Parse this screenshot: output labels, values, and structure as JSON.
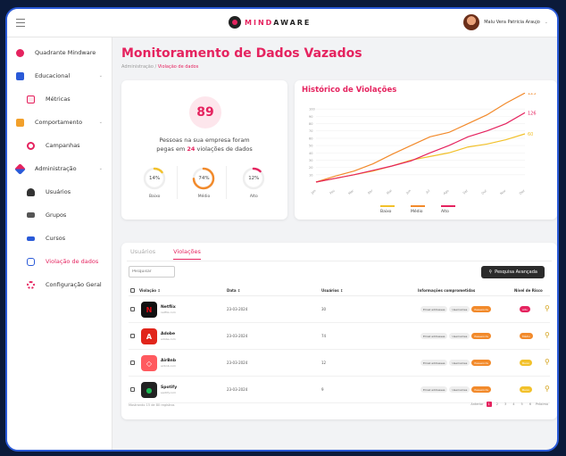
{
  "app": {
    "logo_text_a": "MIND",
    "logo_text_b": "AWARE"
  },
  "user": {
    "name": "Malu Vera Patricia Araujo"
  },
  "sidebar": {
    "items": [
      {
        "label": "Quadrante Mindware",
        "color": "#e5235f"
      },
      {
        "label": "Educacional",
        "color": "#2a5ad8"
      },
      {
        "label": "Métricas",
        "color": "#e5235f"
      },
      {
        "label": "Comportamento",
        "color": "#f2a02b"
      },
      {
        "label": "Campanhas",
        "color": "#e5235f"
      },
      {
        "label": "Administração",
        "color": "#2a5ad8"
      },
      {
        "label": "Usuários",
        "color": "#333333"
      },
      {
        "label": "Grupos",
        "color": "#333333"
      },
      {
        "label": "Cursos",
        "color": "#2a5ad8"
      },
      {
        "label": "Violação de dados",
        "color": "#e5235f"
      },
      {
        "label": "Configuração Geral",
        "color": "#e5235f"
      }
    ]
  },
  "page": {
    "title": "Monitoramento de Dados Vazados",
    "breadcrumb_root": "Administração /",
    "breadcrumb_current": "Violação de dados"
  },
  "summary": {
    "total": "89",
    "text_line1": "Pessoas na sua empresa foram",
    "text_prefix": "pegas em",
    "text_highlight": "24",
    "text_suffix": "violações de dados",
    "gauges": [
      {
        "value": "14%",
        "label": "Baixo",
        "pct": 14,
        "color": "#f2c12b"
      },
      {
        "value": "74%",
        "label": "Médio",
        "pct": 74,
        "color": "#f28a2b"
      },
      {
        "value": "12%",
        "label": "Alto",
        "pct": 12,
        "color": "#e5235f"
      }
    ]
  },
  "chart_data": {
    "type": "line",
    "title": "Histórico de Violações",
    "categories": [
      "Jan",
      "Fev",
      "Mar",
      "Abr",
      "Mai",
      "Jun",
      "Jul",
      "Ago",
      "Set",
      "Out",
      "Nov",
      "Dez"
    ],
    "y_ticks": [
      10,
      20,
      30,
      40,
      50,
      60,
      70,
      80,
      90,
      100
    ],
    "ylim": [
      0,
      110
    ],
    "series": [
      {
        "name": "Baixo",
        "color": "#f2c12b",
        "values": [
          0,
          5,
          10,
          15,
          22,
          30,
          35,
          40,
          48,
          52,
          58,
          66
        ],
        "end_label": "60"
      },
      {
        "name": "Médio",
        "color": "#f28a2b",
        "values": [
          0,
          8,
          15,
          25,
          38,
          50,
          62,
          68,
          80,
          92,
          108,
          122
        ],
        "end_label": "123"
      },
      {
        "name": "Alto",
        "color": "#e5235f",
        "values": [
          0,
          5,
          10,
          16,
          22,
          29,
          40,
          50,
          62,
          70,
          80,
          95
        ],
        "end_label": "126"
      }
    ]
  },
  "tabs": [
    {
      "label": "Usuários"
    },
    {
      "label": "Violações"
    }
  ],
  "search": {
    "placeholder": "Pesquisar"
  },
  "adv_search": {
    "label": "Pesquisa Avançada"
  },
  "table": {
    "headers": {
      "violation": "Violação ↕",
      "date": "Data ↕",
      "users": "Usuários ↕",
      "info": "Informações comprometidas",
      "risk": "Nível de Risco"
    },
    "rows": [
      {
        "name": "Netflix",
        "url": "netflix.com",
        "date": "23-03-2024",
        "users": "30",
        "chips": [
          "Email addresses",
          "Usernames",
          "Passwords"
        ],
        "risk": "Alto",
        "risk_color": "#e5235f",
        "logo_color": "#111111",
        "logo_text_color": "#e50914",
        "logo_letter": "N"
      },
      {
        "name": "Adobe",
        "url": "adobe.com",
        "date": "23-03-2024",
        "users": "74",
        "chips": [
          "Email addresses",
          "Usernames",
          "Passwords"
        ],
        "risk": "Médio",
        "risk_color": "#f28a2b",
        "logo_color": "#e1251b",
        "logo_text_color": "#ffffff",
        "logo_letter": "A"
      },
      {
        "name": "AirBnb",
        "url": "airbnb.com",
        "date": "23-03-2024",
        "users": "12",
        "chips": [
          "Email addresses",
          "Usernames",
          "Passwords"
        ],
        "risk": "Baixo",
        "risk_color": "#f2c12b",
        "logo_color": "#ff5a5f",
        "logo_text_color": "#ffffff",
        "logo_letter": "◇"
      },
      {
        "name": "Spotify",
        "url": "spotify.com",
        "date": "23-03-2024",
        "users": "9",
        "chips": [
          "Email addresses",
          "Usernames",
          "Passwords"
        ],
        "risk": "Baixo",
        "risk_color": "#f2c12b",
        "logo_color": "#222222",
        "logo_text_color": "#1db954",
        "logo_letter": "●"
      }
    ],
    "footer": "Mostrando 15 de 80 registros",
    "pager": {
      "prev": "Anterior",
      "pages": [
        "1",
        "2",
        "3",
        "4",
        "5",
        "6"
      ],
      "active": "1",
      "next": "Próximo"
    }
  }
}
